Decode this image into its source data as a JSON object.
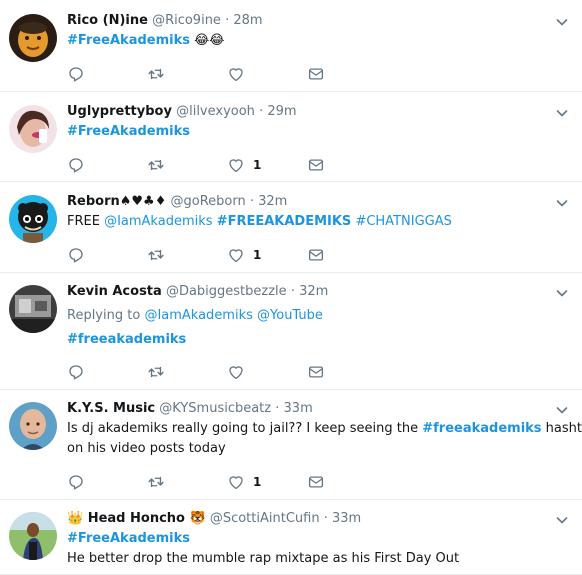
{
  "tweets": [
    {
      "name": "Rico (N)ine",
      "handle": "@Rico9ine",
      "sep": "·",
      "time": "28m",
      "text": [
        {
          "t": "#FreeAkademiks",
          "k": "tag"
        },
        {
          "t": " 😂😂",
          "k": "plain"
        }
      ],
      "likes": "",
      "avatar": "orange-kid"
    },
    {
      "name": "Uglyprettyboy",
      "handle": "@lilvexyooh",
      "sep": "·",
      "time": "29m",
      "text": [
        {
          "t": "#FreeAkademiks",
          "k": "tag"
        }
      ],
      "likes": "1",
      "avatar": "pink-selfie"
    },
    {
      "name": "Reborn♠♥♣♦",
      "handle": "@goReborn",
      "sep": "·",
      "time": "32m",
      "text": [
        {
          "t": "FREE ",
          "k": "plain"
        },
        {
          "t": "@IamAkademiks",
          "k": "link"
        },
        {
          "t": " ",
          "k": "plain"
        },
        {
          "t": "#FREEAKADEMIKS",
          "k": "tag"
        },
        {
          "t": " ",
          "k": "plain"
        },
        {
          "t": "#CHATNIGGAS",
          "k": "link"
        }
      ],
      "likes": "1",
      "avatar": "blue-cartoon"
    },
    {
      "name": "Kevin Acosta",
      "handle": "@Dabiggestbezzle",
      "sep": "·",
      "time": "32m",
      "reply": {
        "prefix": "Replying to ",
        "users": "@IamAkademiks @YouTube"
      },
      "text": [
        {
          "t": "#freeakademiks",
          "k": "tag"
        }
      ],
      "likes": "",
      "avatar": "dark-photo"
    },
    {
      "name": "K.Y.S. Music",
      "handle": "@KYSmusicbeatz",
      "sep": "·",
      "time": "33m",
      "text": [
        {
          "t": "Is dj akademiks really going to jail?? I keep seeing the ",
          "k": "plain"
        },
        {
          "t": "#freeakademiks",
          "k": "tag"
        },
        {
          "t": " hashtags",
          "k": "plain"
        }
      ],
      "text2": "on his video posts today",
      "likes": "1",
      "avatar": "bald-man"
    },
    {
      "name": "👑 Head Honcho 🐯",
      "handle": "@ScottiAintCufin",
      "sep": "·",
      "time": "33m",
      "text": [
        {
          "t": "#FreeAkademiks",
          "k": "tag"
        }
      ],
      "text2": "He better drop the mumble rap mixtape as his First Day Out",
      "likes": "",
      "avatar": "outdoor-man"
    }
  ],
  "icons": {
    "reply": "reply-icon",
    "retweet": "retweet-icon",
    "like": "heart-icon",
    "dm": "envelope-icon",
    "caret": "chevron-down-icon"
  },
  "colors": {
    "link": "#1b95e0",
    "muted": "#657786",
    "divider": "#e6ecf0",
    "icon": "#657786"
  }
}
